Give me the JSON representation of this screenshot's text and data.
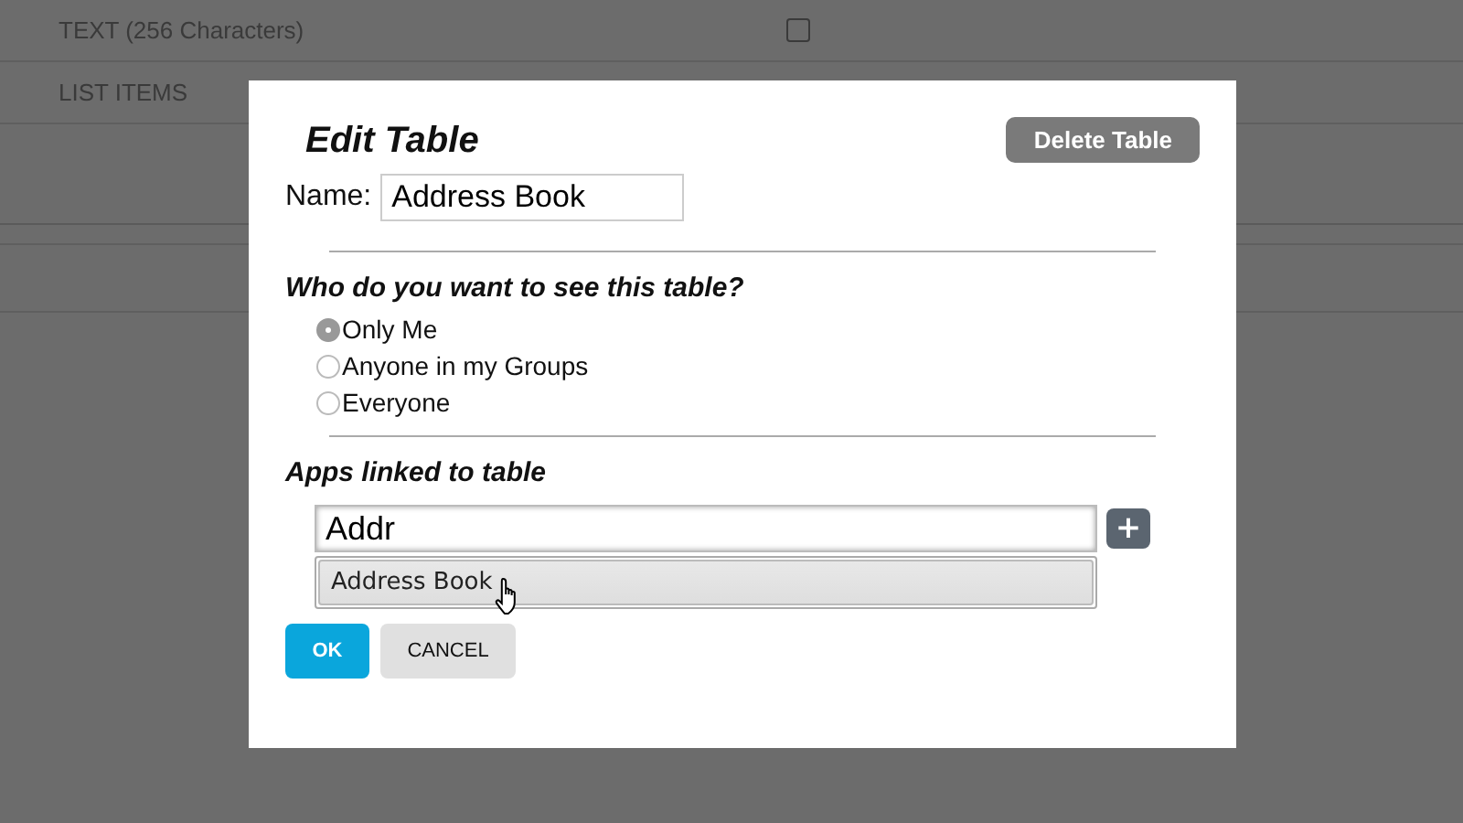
{
  "background_rows": [
    {
      "label": "TEXT (256 Characters)",
      "checked": false
    },
    {
      "label": "LIST ITEMS"
    }
  ],
  "dialog": {
    "title": "Edit Table",
    "delete_button": "Delete Table",
    "name_label": "Name:",
    "name_value": "Address Book",
    "visibility_question": "Who do you want to see this table?",
    "visibility_options": [
      {
        "label": "Only Me",
        "selected": true
      },
      {
        "label": "Anyone in my Groups",
        "selected": false
      },
      {
        "label": "Everyone",
        "selected": false
      }
    ],
    "apps_heading": "Apps linked to table",
    "app_search_value": "Addr",
    "add_button": "+",
    "suggestions": [
      {
        "label": "Address Book",
        "hovered": true
      }
    ],
    "ok_button": "OK",
    "cancel_button": "CANCEL"
  }
}
